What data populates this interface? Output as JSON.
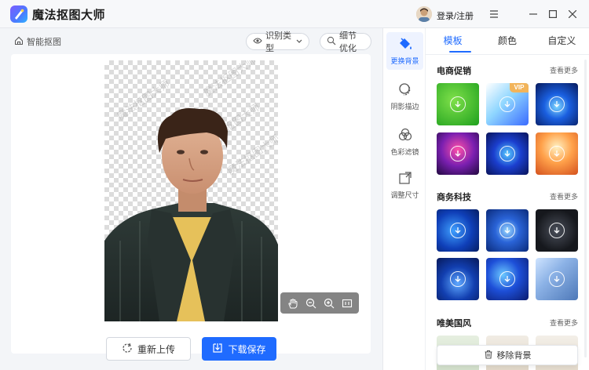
{
  "app": {
    "title": "魔法抠图大师",
    "login_label": "登录/注册"
  },
  "editor": {
    "breadcrumb": "智能抠图",
    "recognize_type_label": "识别类型",
    "detail_optimize_label": "细节优化",
    "watermark_text": "魔法抠图大师",
    "reupload_label": "重新上传",
    "download_label": "下载保存"
  },
  "rail": {
    "items": [
      {
        "label": "更换背景",
        "active": true
      },
      {
        "label": "阴影描边",
        "active": false
      },
      {
        "label": "色彩滤镜",
        "active": false
      },
      {
        "label": "调整尺寸",
        "active": false
      }
    ]
  },
  "panel": {
    "tabs": [
      {
        "label": "模板",
        "active": true
      },
      {
        "label": "颜色",
        "active": false
      },
      {
        "label": "自定义",
        "active": false
      }
    ],
    "more_label": "查看更多",
    "sections": [
      {
        "title": "电商促销"
      },
      {
        "title": "商务科技"
      },
      {
        "title": "唯美国风"
      }
    ],
    "vip_badge": "VIP",
    "remove_bg_label": "移除背景"
  },
  "colors": {
    "accent": "#1f6bff",
    "active_tab": "#1f6bff",
    "download_bg": "#1f6bff"
  }
}
